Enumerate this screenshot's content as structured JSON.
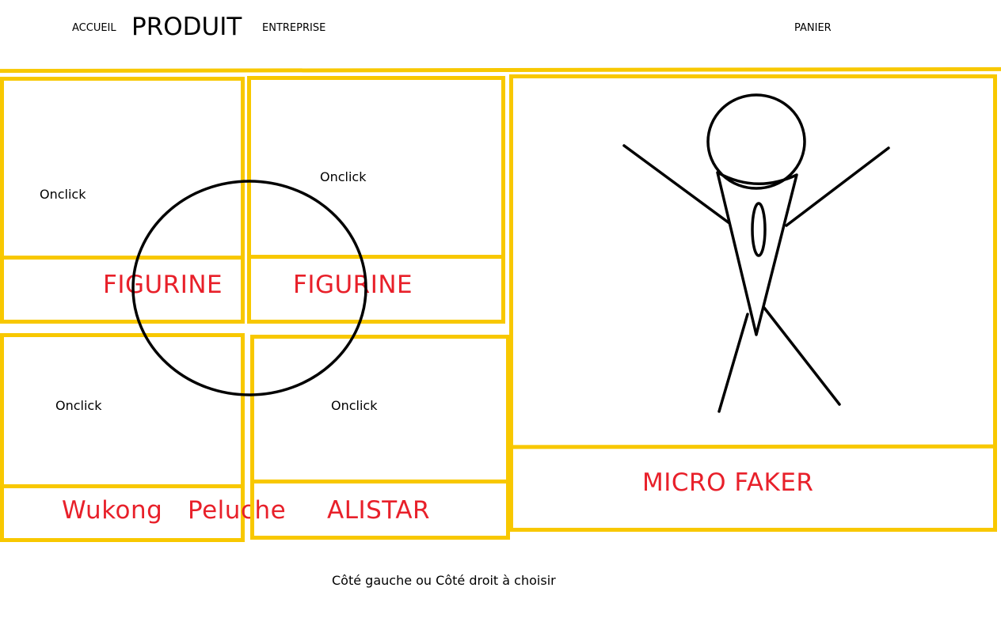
{
  "nav": {
    "accueil": "ACCUEIL",
    "produit": "PRODUIT",
    "entreprise": "ENTREPRISE",
    "panier": "PANIER"
  },
  "cards": [
    {
      "onclick": "Onclick",
      "label": "FIGURINE"
    },
    {
      "onclick": "Onclick",
      "label": "FIGURINE"
    },
    {
      "onclick": "Onclick",
      "label": "Wukong",
      "label2": "Peluche"
    },
    {
      "onclick": "Onclick",
      "label": "ALISTAR"
    }
  ],
  "feature": {
    "label": "MICRO FAKER",
    "icon": "stick-figure-icon"
  },
  "footer": {
    "note": "Côté gauche ou Côté droit à choisir"
  },
  "colors": {
    "border": "#f8c800",
    "label": "#e8202a",
    "ink": "#000000"
  }
}
